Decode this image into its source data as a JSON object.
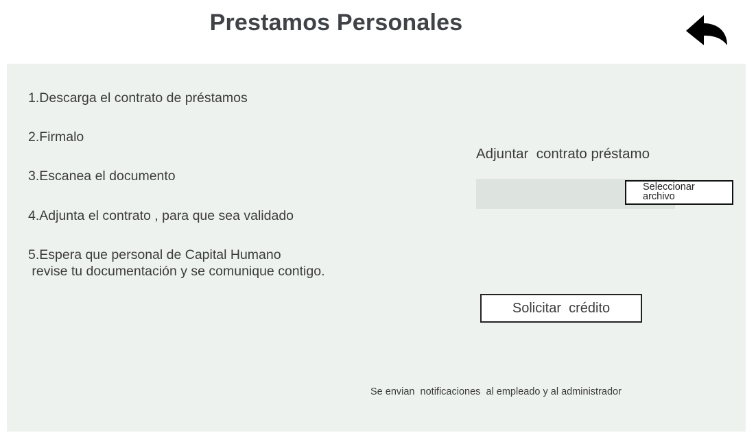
{
  "header": {
    "title": "Prestamos Personales",
    "back_icon": "reply-back-arrow-icon"
  },
  "steps": [
    "1.Descarga el contrato de préstamos",
    "2.Firmalo",
    "3.Escanea el documento",
    "4.Adjunta el contrato , para que sea validado",
    "5.Espera que personal de Capital Humano\n revise tu documentación y se comunique contigo."
  ],
  "attachment": {
    "label": "Adjuntar  contrato préstamo",
    "file_value": "",
    "select_button_label": "Seleccionar archivo"
  },
  "actions": {
    "request_label": "Solicitar  crédito"
  },
  "footer": {
    "note": "Se envian  notificaciones  al empleado y al administrador"
  },
  "colors": {
    "panel_background": "#eef2ef",
    "file_field_background": "#dde4df",
    "title_color": "#3f4246",
    "icon_color": "#000000"
  }
}
